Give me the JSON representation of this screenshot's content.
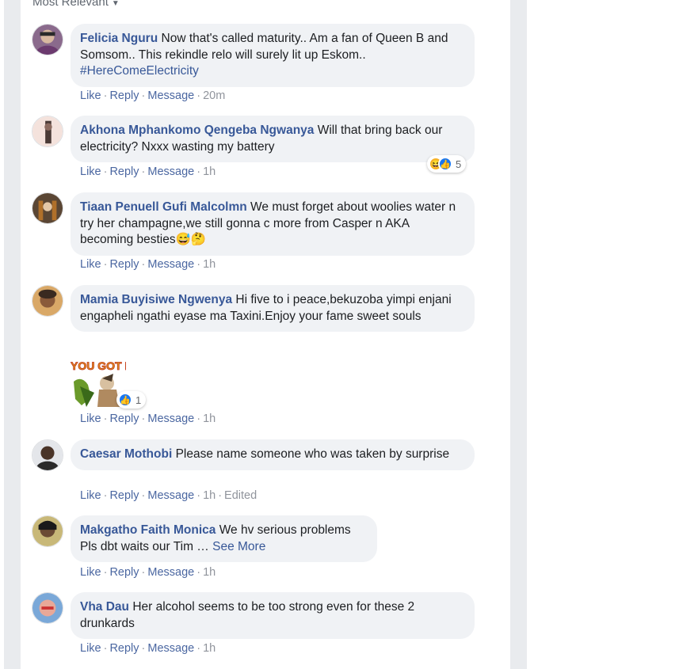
{
  "header": {
    "sort_label": "Most Relevant"
  },
  "actions": {
    "like": "Like",
    "reply": "Reply",
    "message": "Message"
  },
  "comments": [
    {
      "name": "Felicia Nguru",
      "text": "Now that's called maturity.. Am a fan of Queen B and Somsom.. This rekindle relo will surely lit up Eskom..",
      "hashtag": "#HereComeElectricity",
      "time": "20m"
    },
    {
      "name": "Akhona Mphankomo Qengeba Ngwanya",
      "text": "Will that bring back our electricity? Nxxx wasting my battery",
      "time": "1h",
      "reaction_count": "5"
    },
    {
      "name": "Tiaan Penuell Gufi Malcolmn",
      "text": "We must forget about woolies water n try her champagne,we still gonna c more from Casper n AKA becoming besties😅🤔",
      "time": "1h"
    },
    {
      "name": "Mamia Buyisiwe Ngwenya",
      "text": "Hi five to i peace,bekuzoba yimpi enjani engapheli ngathi eyase ma Taxini.Enjoy your fame sweet souls",
      "time": "1h",
      "sticker_text": "YOU GOT IT",
      "reaction_count": "1"
    },
    {
      "name": "Caesar Mothobi",
      "text": "Please name someone who was taken by surprise",
      "time": "1h",
      "edited": "Edited"
    },
    {
      "name": "Makgatho Faith Monica",
      "text": "We hv serious problems Pls dbt waits our Tim …",
      "see_more": "See More",
      "time": "1h"
    },
    {
      "name": "Vha Dau",
      "text": "Her alcohol seems to be too strong even for these 2 drunkards",
      "time": "1h"
    }
  ],
  "colors": {
    "name_link": "#385898",
    "action_link": "#4b67a1",
    "bubble_bg": "#f0f2f5",
    "page_bg": "#e9ebee"
  }
}
